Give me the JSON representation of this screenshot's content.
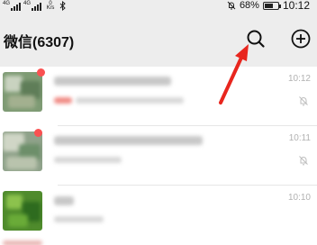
{
  "status_bar": {
    "network_label": "4G",
    "speed_value": "0",
    "speed_unit": "K/s",
    "battery_percent": "68%",
    "battery_level": 0.68,
    "time": "10:12",
    "icons": [
      "signal-icon",
      "bluetooth-icon",
      "alarm-off-icon",
      "battery-icon"
    ]
  },
  "header": {
    "title": "微信(6307)",
    "search_icon": "search-icon",
    "add_icon": "plus-circle-icon"
  },
  "chats": [
    {
      "time": "10:12",
      "has_badge": true,
      "muted": true
    },
    {
      "time": "10:11",
      "has_badge": true,
      "muted": true
    },
    {
      "time": "10:10",
      "has_badge": false,
      "muted": false
    }
  ],
  "colors": {
    "header_bg": "#ededed",
    "badge": "#fa5151",
    "arrow": "#e8261e",
    "timestamp": "#b2b2b2"
  }
}
